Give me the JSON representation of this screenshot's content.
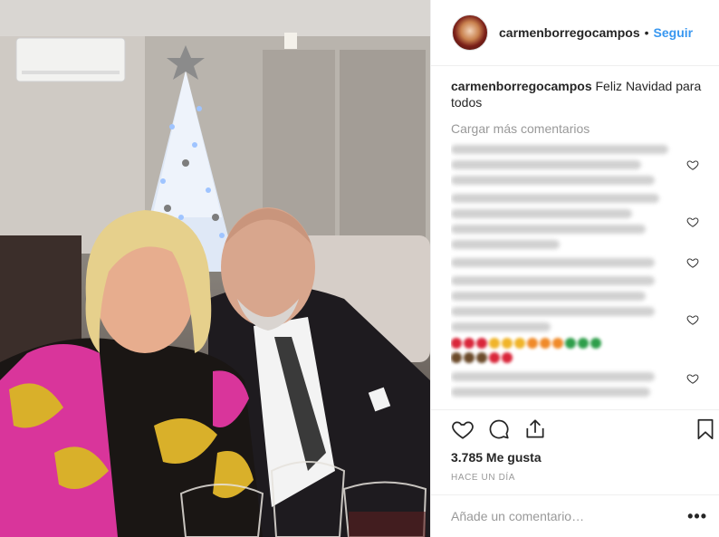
{
  "post": {
    "username": "carmenborregocampos",
    "follow_label": "Seguir",
    "caption_user": "carmenborregocampos",
    "caption_text": "Feliz Navidad para todos",
    "load_more": "Cargar más comentarios",
    "likes": "3.785 Me gusta",
    "time": "HACE UN DÍA",
    "comment_placeholder": "Añade un comentario…",
    "more_label": "•••"
  },
  "icons": {
    "like": "heart-icon",
    "comment": "comment-icon",
    "share": "share-icon",
    "save": "bookmark-icon",
    "comment_like": "heart-icon"
  },
  "colors": {
    "link": "#3897f0",
    "text": "#262626",
    "muted": "#999999",
    "border": "#efefef"
  }
}
